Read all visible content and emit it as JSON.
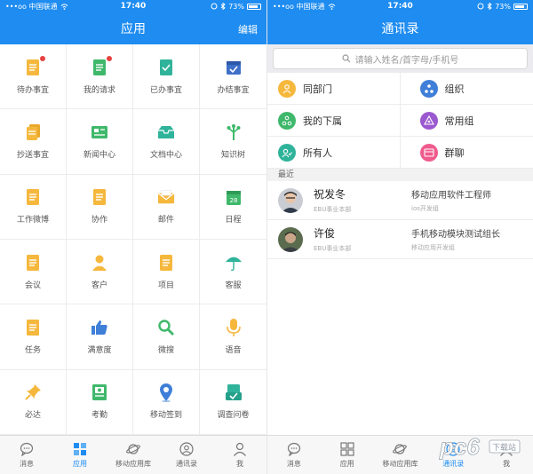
{
  "status": {
    "carrier": "•••oo 中国联通",
    "time": "17:40",
    "battery": "73%"
  },
  "left": {
    "title": "应用",
    "edit": "编辑",
    "apps": [
      {
        "label": "待办事宜",
        "icon": "todo-icon",
        "badge": true
      },
      {
        "label": "我的请求",
        "icon": "request-icon",
        "badge": true
      },
      {
        "label": "已办事宜",
        "icon": "done-icon",
        "badge": false
      },
      {
        "label": "办结事宜",
        "icon": "closed-icon",
        "badge": false
      },
      {
        "label": "抄送事宜",
        "icon": "cc-icon",
        "badge": false
      },
      {
        "label": "新闻中心",
        "icon": "news-icon",
        "badge": false
      },
      {
        "label": "文档中心",
        "icon": "docs-icon",
        "badge": false
      },
      {
        "label": "知识树",
        "icon": "tree-icon",
        "badge": false
      },
      {
        "label": "工作微博",
        "icon": "weibo-icon",
        "badge": false
      },
      {
        "label": "协作",
        "icon": "collab-icon",
        "badge": false
      },
      {
        "label": "邮件",
        "icon": "mail-icon",
        "badge": false
      },
      {
        "label": "日程",
        "icon": "calendar-icon",
        "badge": false
      },
      {
        "label": "会议",
        "icon": "meeting-icon",
        "badge": false
      },
      {
        "label": "客户",
        "icon": "customer-icon",
        "badge": false
      },
      {
        "label": "项目",
        "icon": "project-icon",
        "badge": false
      },
      {
        "label": "客服",
        "icon": "umbrella-icon",
        "badge": false
      },
      {
        "label": "任务",
        "icon": "task-icon",
        "badge": false
      },
      {
        "label": "满意度",
        "icon": "thumbs-up-icon",
        "badge": false
      },
      {
        "label": "微搜",
        "icon": "search-icon",
        "badge": false
      },
      {
        "label": "语音",
        "icon": "microphone-icon",
        "badge": false
      },
      {
        "label": "必达",
        "icon": "pin-icon",
        "badge": false
      },
      {
        "label": "考勤",
        "icon": "attendance-icon",
        "badge": false
      },
      {
        "label": "移动签到",
        "icon": "location-icon",
        "badge": false
      },
      {
        "label": "调查问卷",
        "icon": "survey-icon",
        "badge": false
      }
    ],
    "tabs": [
      {
        "label": "消息",
        "icon": "chat-bubble-icon",
        "active": false
      },
      {
        "label": "应用",
        "icon": "apps-grid-icon",
        "active": true
      },
      {
        "label": "移动应用库",
        "icon": "planet-icon",
        "active": false
      },
      {
        "label": "通讯录",
        "icon": "contact-icon",
        "active": false
      },
      {
        "label": "我",
        "icon": "person-icon",
        "active": false
      }
    ]
  },
  "right": {
    "title": "通讯录",
    "search_placeholder": "请输入姓名/首字母/手机号",
    "groups": [
      {
        "label": "同部门",
        "icon": "same-dept-icon",
        "color": "#f5b83d"
      },
      {
        "label": "组织",
        "icon": "org-icon",
        "color": "#3f7fd8"
      },
      {
        "label": "我的下属",
        "icon": "subordinates-icon",
        "color": "#3fb86b"
      },
      {
        "label": "常用组",
        "icon": "common-group-icon",
        "color": "#9b59d0"
      },
      {
        "label": "所有人",
        "icon": "everyone-icon",
        "color": "#2fb39a"
      },
      {
        "label": "群聊",
        "icon": "group-chat-icon",
        "color": "#ef5b8c"
      }
    ],
    "recent_label": "最近",
    "contacts": [
      {
        "name": "祝发冬",
        "dept": "EBU事业本部",
        "title": "移动应用软件工程师",
        "team": "ios开发组"
      },
      {
        "name": "许俊",
        "dept": "EBU事业本部",
        "title": "手机移动模块测试组长",
        "team": "移动应用开发组"
      }
    ],
    "tabs": [
      {
        "label": "消息",
        "icon": "chat-bubble-icon",
        "active": false
      },
      {
        "label": "应用",
        "icon": "apps-grid-icon",
        "active": false
      },
      {
        "label": "移动应用库",
        "icon": "planet-icon",
        "active": false
      },
      {
        "label": "通讯录",
        "icon": "contact-icon",
        "active": true
      },
      {
        "label": "我",
        "icon": "person-icon",
        "active": false
      }
    ]
  },
  "watermark": {
    "text": "pc6",
    "sub": "下载站"
  },
  "colors": {
    "brand_blue": "#1e8cf0",
    "icon_yellow": "#f5b83d",
    "icon_green": "#3fb86b",
    "icon_teal": "#2fb39a",
    "badge_red": "#e64340"
  }
}
